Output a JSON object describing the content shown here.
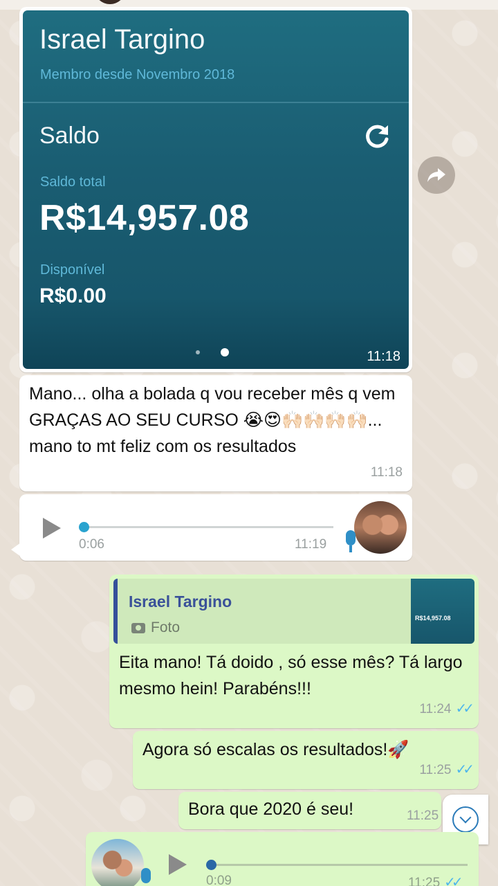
{
  "photo_message": {
    "name": "Israel Targino",
    "member_since": "Membro desde Novembro 2018",
    "section_title": "Saldo",
    "total_label": "Saldo total",
    "total_value": "R$14,957.08",
    "available_label": "Disponível",
    "available_value": "R$0.00",
    "time": "11:18",
    "refresh_icon": "refresh-icon",
    "page_indicator": {
      "count": 2,
      "active": 2
    }
  },
  "forward_icon": "forward-icon",
  "incoming_text": {
    "text": "Mano... olha a bolada q vou receber mês q vem GRAÇAS AO SEU CURSO 😭😍🙌🏻🙌🏻🙌🏻🙌🏻... mano to mt feliz com os resultados",
    "time": "11:18"
  },
  "incoming_audio": {
    "duration": "0:06",
    "time": "11:19",
    "progress": 0
  },
  "reply_message": {
    "quoted_name": "Israel Targino",
    "quoted_type": "Foto",
    "thumb_amount": "R$14,957.08",
    "text": "Eita mano! Tá doido , só esse mês? Tá largo mesmo hein! Parabéns!!!",
    "time": "11:24",
    "status": "✓✓"
  },
  "outgoing_1": {
    "text": "Agora só escalas os resultados!🚀",
    "time": "11:25",
    "status": "✓✓"
  },
  "outgoing_2": {
    "text": "Bora que 2020 é seu!",
    "time": "11:25"
  },
  "outgoing_audio": {
    "duration": "0:09",
    "time": "11:25",
    "status": "✓✓",
    "progress": 0
  },
  "colors": {
    "incoming_bubble": "#ffffff",
    "outgoing_bubble": "#dcf8c6",
    "read_ticks": "#4fb6ec",
    "audio_knob_in": "#2aa3cf"
  }
}
